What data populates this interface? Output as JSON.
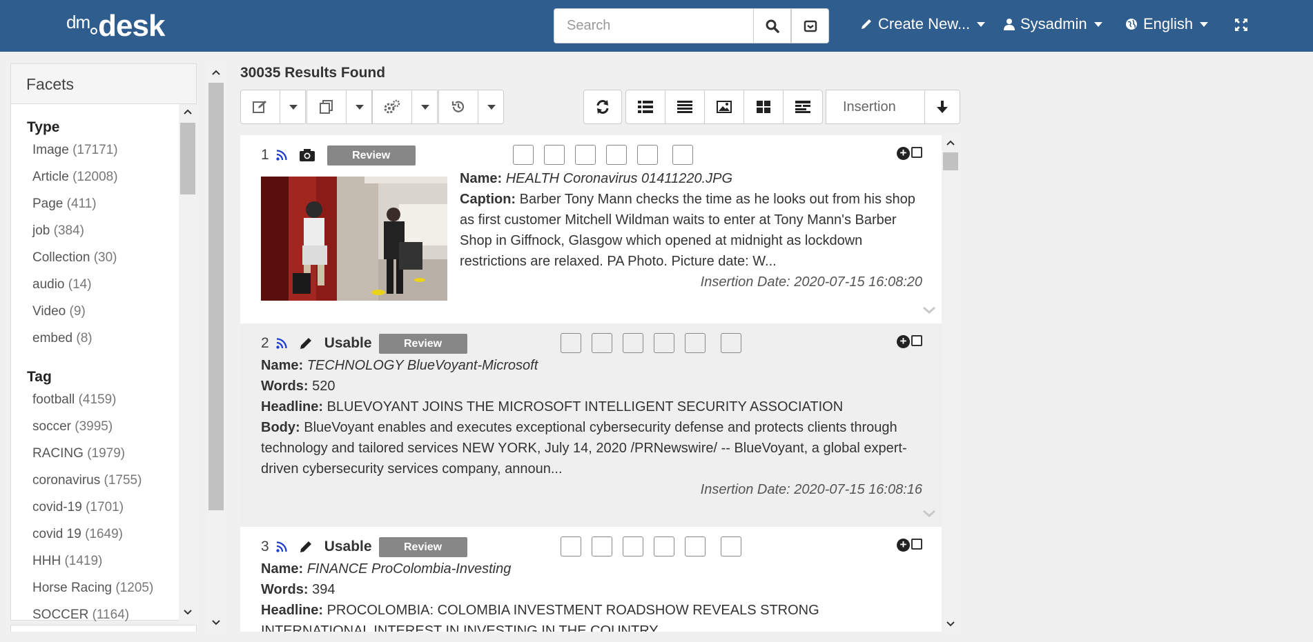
{
  "brand": {
    "dm": "dm",
    "desk": "desk"
  },
  "header": {
    "search_placeholder": "Search",
    "create_new": "Create New...",
    "user": "Sysadmin",
    "language": "English"
  },
  "facets": {
    "title": "Facets",
    "groups": [
      {
        "title": "Type",
        "items": [
          {
            "label": "Image",
            "count": "(17171)"
          },
          {
            "label": "Article",
            "count": "(12008)"
          },
          {
            "label": "Page",
            "count": "(411)"
          },
          {
            "label": "job",
            "count": "(384)"
          },
          {
            "label": "Collection",
            "count": "(30)"
          },
          {
            "label": "audio",
            "count": "(14)"
          },
          {
            "label": "Video",
            "count": "(9)"
          },
          {
            "label": "embed",
            "count": "(8)"
          }
        ]
      },
      {
        "title": "Tag",
        "items": [
          {
            "label": "football",
            "count": "(4159)"
          },
          {
            "label": "soccer",
            "count": "(3995)"
          },
          {
            "label": "RACING",
            "count": "(1979)"
          },
          {
            "label": "coronavirus",
            "count": "(1755)"
          },
          {
            "label": "covid-19",
            "count": "(1701)"
          },
          {
            "label": "covid 19",
            "count": "(1649)"
          },
          {
            "label": "HHH",
            "count": "(1419)"
          },
          {
            "label": "Horse Racing",
            "count": "(1205)"
          },
          {
            "label": "SOCCER",
            "count": "(1164)"
          }
        ]
      }
    ]
  },
  "results": {
    "count_text": "30035 Results Found",
    "sort_field": "Insertion"
  },
  "items": [
    {
      "num": "1",
      "status": "",
      "review": "Review",
      "name_label": "Name:",
      "name": "HEALTH Coronavirus 01411220.JPG",
      "caption_label": "Caption:",
      "caption": "Barber Tony Mann checks the time as he looks out from his shop as first customer Mitchell Wildman waits to enter at Tony Mann's Barber Shop in Giffnock, Glasgow which opened at midnight as lockdown restrictions are relaxed. PA Photo. Picture date: W...",
      "insertion": "Insertion Date: 2020-07-15 16:08:20"
    },
    {
      "num": "2",
      "status": "Usable",
      "review": "Review",
      "name_label": "Name:",
      "name": "TECHNOLOGY BlueVoyant-Microsoft",
      "words_label": "Words:",
      "words": "520",
      "headline_label": "Headline:",
      "headline": "BLUEVOYANT JOINS THE MICROSOFT INTELLIGENT SECURITY ASSOCIATION",
      "body_label": "Body:",
      "body": "BlueVoyant enables and executes exceptional cybersecurity defense and protects clients through technology and tailored services NEW YORK, July 14, 2020 /PRNewswire/ -- BlueVoyant, a global expert-driven cybersecurity services company, announ...",
      "insertion": "Insertion Date: 2020-07-15 16:08:16"
    },
    {
      "num": "3",
      "status": "Usable",
      "review": "Review",
      "name_label": "Name:",
      "name": "FINANCE ProColombia-Investing",
      "words_label": "Words:",
      "words": "394",
      "headline_label": "Headline:",
      "headline": "PROCOLOMBIA: COLOMBIA INVESTMENT ROADSHOW REVEALS STRONG INTERNATIONAL INTEREST IN INVESTING IN THE COUNTRY"
    }
  ]
}
